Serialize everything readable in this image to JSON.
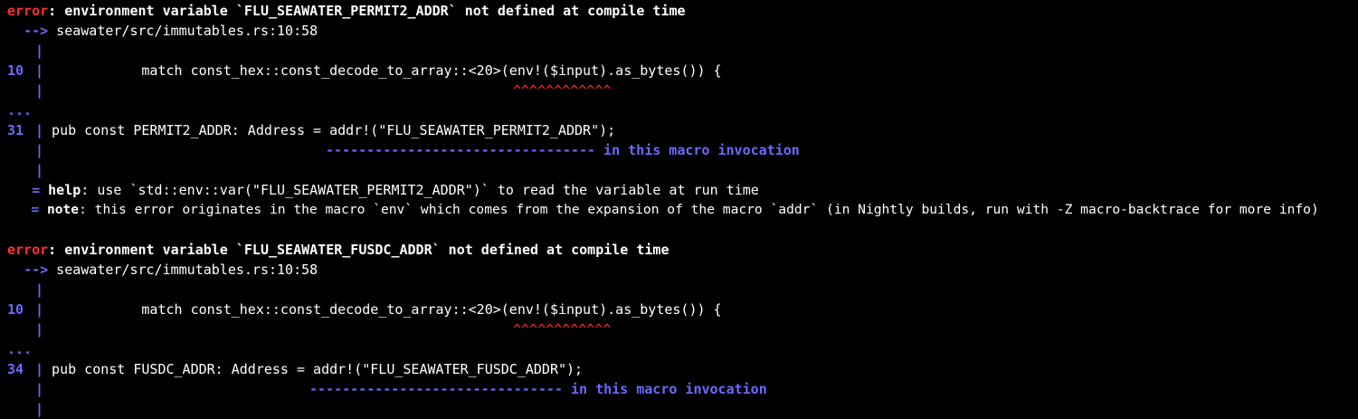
{
  "colors": {
    "background": "#000000",
    "text": "#ffffff",
    "error": "#ff3030",
    "gutter": "#6a6aff",
    "caret": "#ff2a2a"
  },
  "blocks": [
    {
      "error_label": "error",
      "error_message": ": environment variable `FLU_SEAWATER_PERMIT2_ADDR` not defined at compile time",
      "arrow": "-->",
      "location": " seawater/src/immutables.rs:10:58",
      "pipe": "|",
      "line1_no": "10",
      "line1_code": "            match const_hex::const_decode_to_array::<20>(env!($input).as_bytes()) {",
      "carets": "^^^^^^^^^^^^",
      "ellipsis": "...",
      "line2_no": "31",
      "line2_code": " pub const PERMIT2_ADDR: Address = addr!(\"FLU_SEAWATER_PERMIT2_ADDR\");",
      "underline": "---------------------------------",
      "underline_label": " in this macro invocation",
      "help_eq": "=",
      "help_label": "help",
      "help_text": ": use `std::env::var(\"FLU_SEAWATER_PERMIT2_ADDR\")` to read the variable at run time",
      "note_eq": "=",
      "note_label": "note",
      "note_text": ": this error originates in the macro `env` which comes from the expansion of the macro `addr` (in Nightly builds, run with -Z macro-backtrace for more info)"
    },
    {
      "error_label": "error",
      "error_message": ": environment variable `FLU_SEAWATER_FUSDC_ADDR` not defined at compile time",
      "arrow": "-->",
      "location": " seawater/src/immutables.rs:10:58",
      "pipe": "|",
      "line1_no": "10",
      "line1_code": "            match const_hex::const_decode_to_array::<20>(env!($input).as_bytes()) {",
      "carets": "^^^^^^^^^^^^",
      "ellipsis": "...",
      "line2_no": "34",
      "line2_code": " pub const FUSDC_ADDR: Address = addr!(\"FLU_SEAWATER_FUSDC_ADDR\");",
      "underline": "-------------------------------",
      "underline_label": " in this macro invocation"
    }
  ]
}
